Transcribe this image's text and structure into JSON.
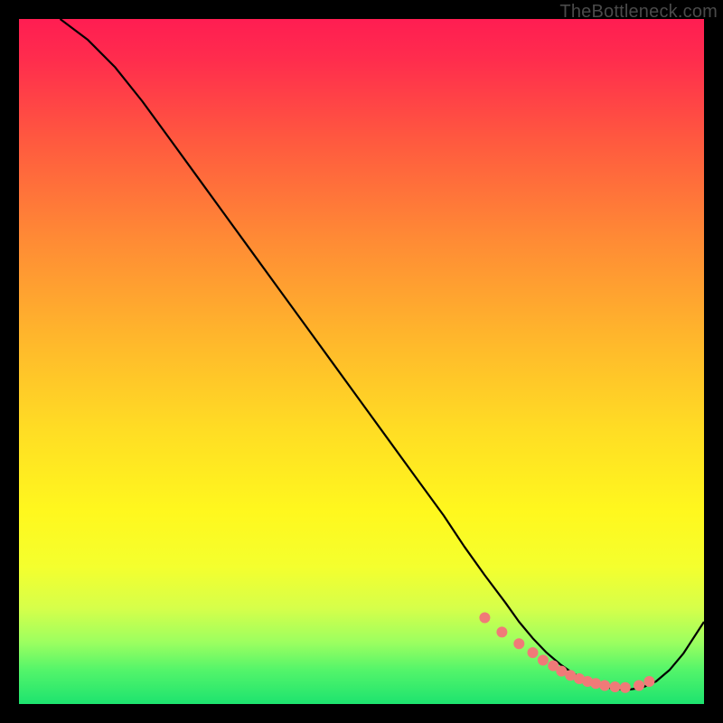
{
  "watermark": "TheBottleneck.com",
  "chart_data": {
    "type": "line",
    "title": "",
    "xlabel": "",
    "ylabel": "",
    "xlim": [
      0,
      100
    ],
    "ylim": [
      0,
      100
    ],
    "series": [
      {
        "name": "curve",
        "x": [
          6,
          10,
          14,
          18,
          22,
          26,
          30,
          34,
          38,
          42,
          46,
          50,
          54,
          58,
          62,
          65,
          68,
          71,
          73,
          75,
          77,
          79,
          81,
          83,
          85,
          87,
          89,
          91,
          93,
          95,
          97,
          100
        ],
        "y": [
          100,
          97,
          93,
          88,
          82.5,
          77,
          71.5,
          66,
          60.5,
          55,
          49.5,
          44,
          38.5,
          33,
          27.5,
          23,
          18.8,
          14.8,
          12,
          9.6,
          7.5,
          5.8,
          4.4,
          3.3,
          2.6,
          2.2,
          2.1,
          2.4,
          3.3,
          5.0,
          7.4,
          12.0
        ]
      }
    ],
    "markers": {
      "name": "dots",
      "x": [
        68.0,
        70.5,
        73.0,
        75.0,
        76.5,
        78.0,
        79.2,
        80.5,
        81.8,
        83.0,
        84.2,
        85.5,
        87.0,
        88.5,
        90.5,
        92.0
      ],
      "y": [
        12.6,
        10.5,
        8.8,
        7.5,
        6.4,
        5.6,
        4.8,
        4.2,
        3.7,
        3.3,
        3.0,
        2.7,
        2.5,
        2.4,
        2.7,
        3.3
      ]
    },
    "gradient_stops": [
      {
        "pos": 0,
        "color": "#ff1d52"
      },
      {
        "pos": 18,
        "color": "#ff5a3f"
      },
      {
        "pos": 46,
        "color": "#ffb52c"
      },
      {
        "pos": 72,
        "color": "#fff81e"
      },
      {
        "pos": 91,
        "color": "#9cff60"
      },
      {
        "pos": 100,
        "color": "#1de36f"
      }
    ]
  }
}
